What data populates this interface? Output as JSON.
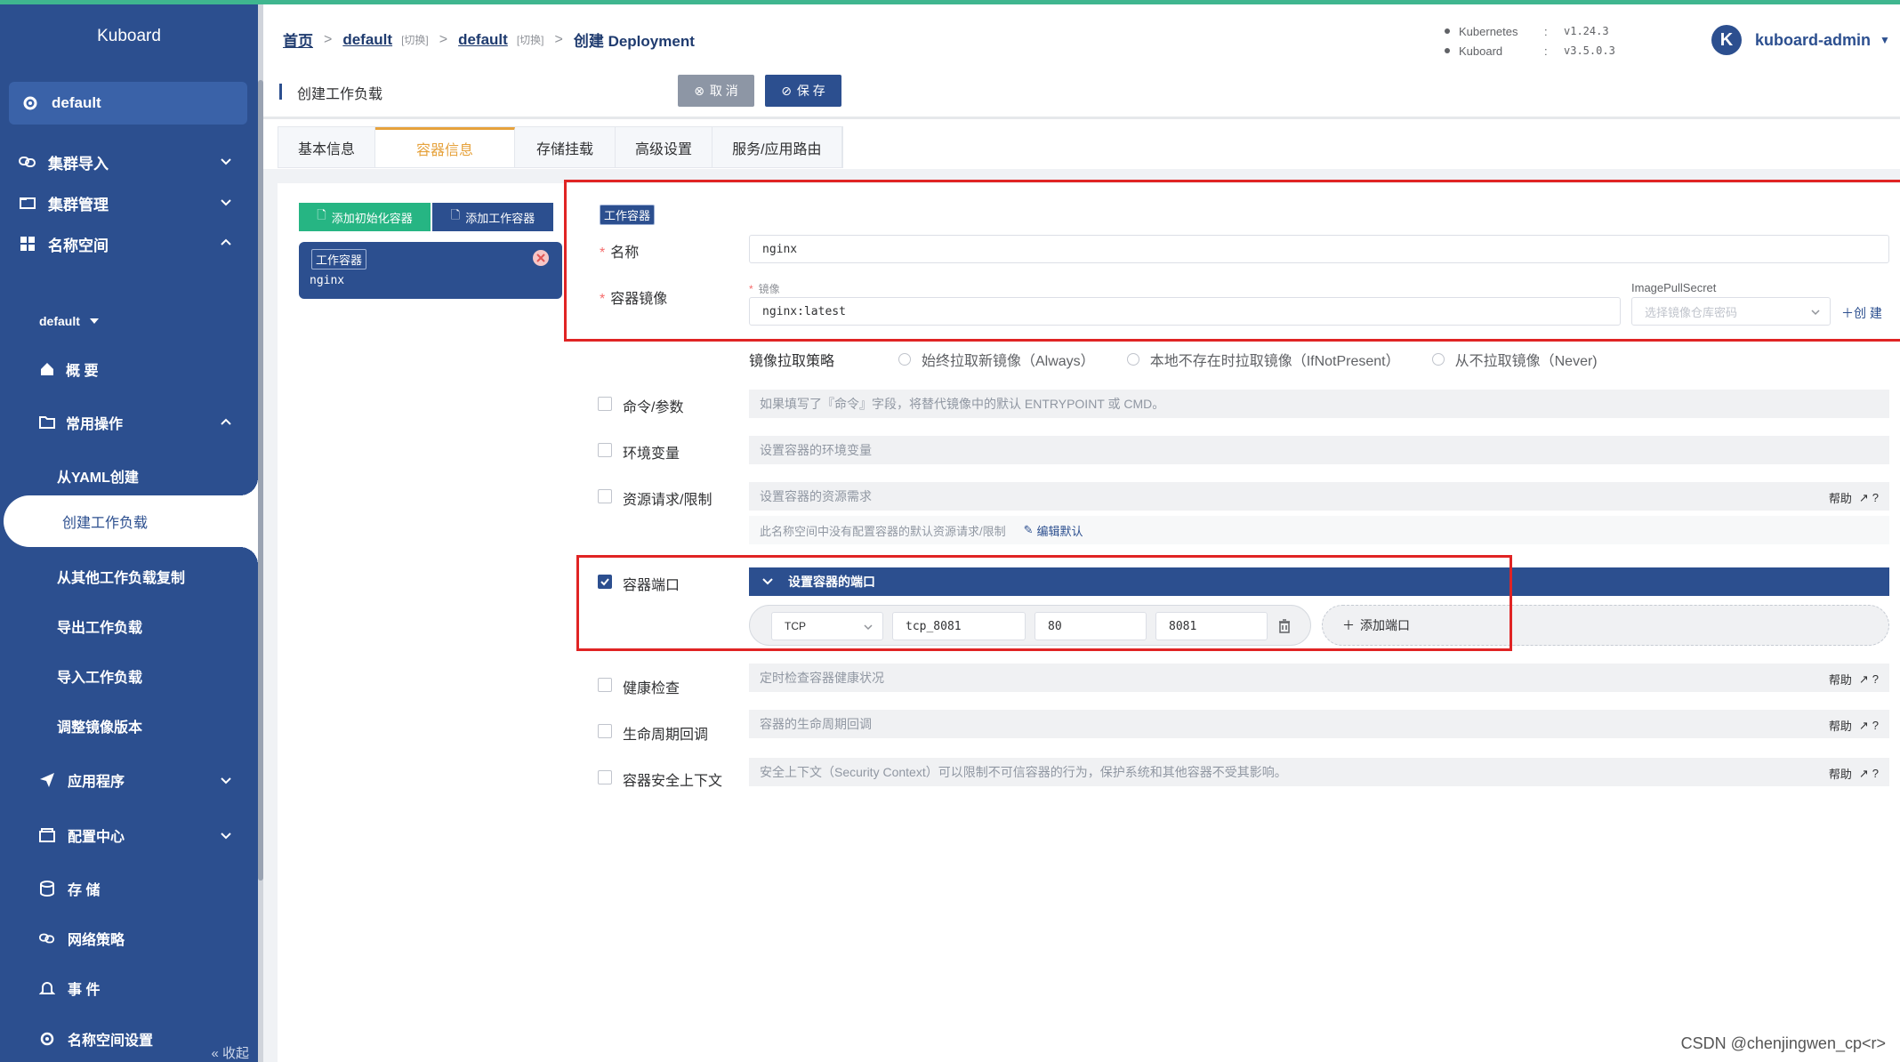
{
  "app": {
    "brand": "Kuboard"
  },
  "sidebar": {
    "namespace_pill": "default",
    "groups": [
      {
        "label": "集群导入"
      },
      {
        "label": "集群管理"
      },
      {
        "label": "名称空间"
      }
    ],
    "ns_selector": "default",
    "items": [
      {
        "label": "概 要"
      },
      {
        "label": "常用操作"
      },
      {
        "label": "从YAML创建"
      },
      {
        "label": "创建工作负载"
      },
      {
        "label": "从其他工作负载复制"
      },
      {
        "label": "导出工作负载"
      },
      {
        "label": "导入工作负载"
      },
      {
        "label": "调整镜像版本"
      },
      {
        "label": "应用程序"
      },
      {
        "label": "配置中心"
      },
      {
        "label": "存 储"
      },
      {
        "label": "网络策略"
      },
      {
        "label": "事 件"
      },
      {
        "label": "名称空间设置"
      }
    ],
    "collapse_label": "« 收起"
  },
  "breadcrumb": {
    "home": "首页",
    "cluster": "default",
    "cluster_switch": "[切换]",
    "namespace": "default",
    "ns_switch": "[切换]",
    "current": "创建 Deployment"
  },
  "versions": [
    {
      "name": "Kubernetes",
      "value": "v1.24.3"
    },
    {
      "name": "Kuboard",
      "value": "v3.5.0.3"
    }
  ],
  "user": {
    "initial": "K",
    "name": "kuboard-admin"
  },
  "toolbar": {
    "title": "创建工作负载",
    "cancel": "取 消",
    "save": "保 存"
  },
  "tabs": [
    "基本信息",
    "容器信息",
    "存储挂载",
    "高级设置",
    "服务/应用路由"
  ],
  "containers": {
    "add_init": "添加初始化容器",
    "add_work": "添加工作容器",
    "card_tag": "工作容器",
    "card_name": "nginx"
  },
  "form": {
    "tag": "工作容器",
    "name_label": "名称",
    "name_value": "nginx",
    "image_label": "容器镜像",
    "image_sub_label": "镜像",
    "image_value": "nginx:latest",
    "pull_secret_label": "ImagePullSecret",
    "pull_secret_placeholder": "选择镜像仓库密码",
    "create_link": "创 建",
    "pull_policy_label": "镜像拉取策略",
    "pull_policies": [
      "始终拉取新镜像（Always）",
      "本地不存在时拉取镜像（IfNotPresent）",
      "从不拉取镜像（Never)"
    ],
    "command_label": "命令/参数",
    "command_placeholder": "如果填写了『命令』字段，将替代镜像中的默认 ENTRYPOINT 或 CMD。",
    "env_label": "环境变量",
    "env_placeholder": "设置容器的环境变量",
    "resource_label": "资源请求/限制",
    "resource_placeholder": "设置容器的资源需求",
    "resource_note": "此名称空间中没有配置容器的默认资源请求/限制",
    "resource_edit": "编辑默认",
    "help": "帮助",
    "ports_label": "容器端口",
    "ports_header": "设置容器的端口",
    "port_protocol": "TCP",
    "port_name": "tcp_8081",
    "port_container": "80",
    "port_host": "8081",
    "add_port": "添加端口",
    "health_label": "健康检查",
    "health_placeholder": "定时检查容器健康状况",
    "lifecycle_label": "生命周期回调",
    "lifecycle_placeholder": "容器的生命周期回调",
    "security_label": "容器安全上下文",
    "security_placeholder": "安全上下文（Security Context）可以限制不可信容器的行为，保护系统和其他容器不受其影响。"
  },
  "watermark": "CSDN @chenjingwen_cp<r>",
  "colors": {
    "primary": "#2c4f8f",
    "accent": "#e6a23c",
    "success": "#26b583",
    "highlight": "#e02424"
  }
}
